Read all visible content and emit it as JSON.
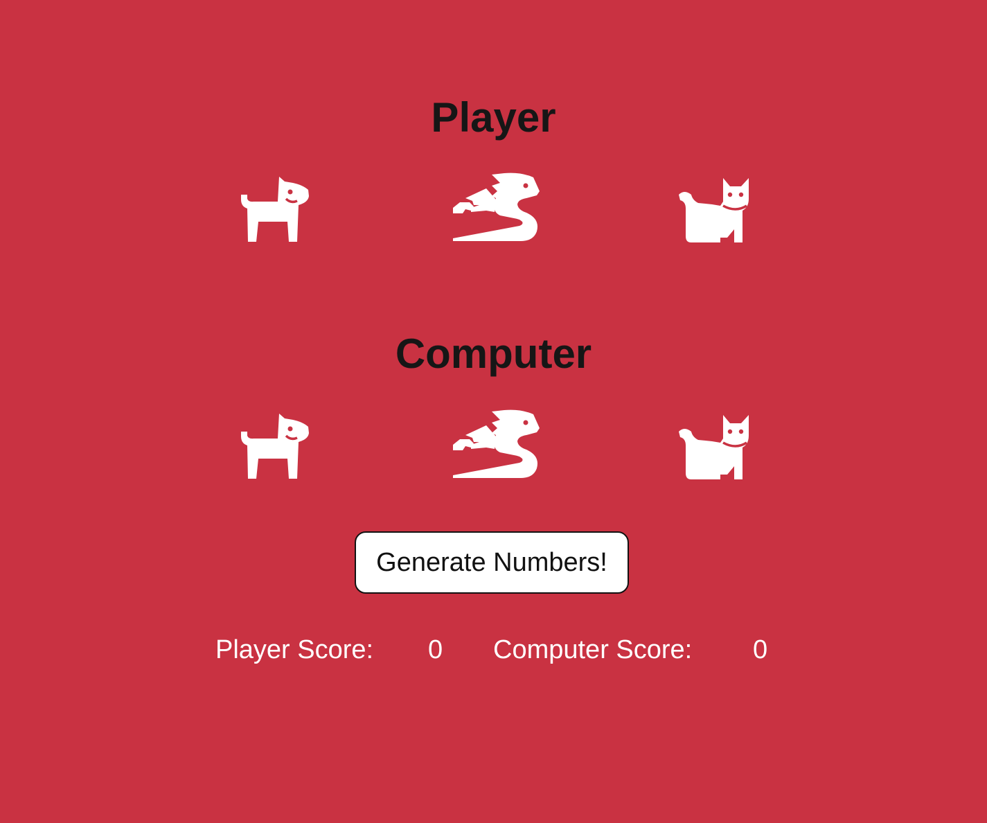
{
  "player": {
    "title": "Player",
    "choices": [
      "dog-icon",
      "dragon-icon",
      "cat-icon"
    ]
  },
  "computer": {
    "title": "Computer",
    "choices": [
      "dog-icon",
      "dragon-icon",
      "cat-icon"
    ]
  },
  "actions": {
    "generate_label": "Generate Numbers!"
  },
  "scores": {
    "player_label": "Player Score:",
    "player_value": "0",
    "computer_label": "Computer Score:",
    "computer_value": "0"
  },
  "colors": {
    "background": "#c93242",
    "icon": "#ffffff",
    "title": "#161616",
    "button_background": "#ffffff",
    "button_border": "#111111"
  }
}
